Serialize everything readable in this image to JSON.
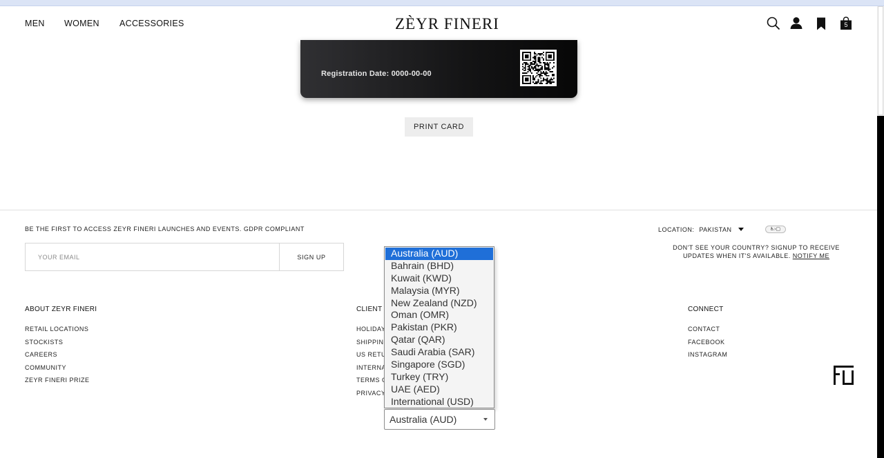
{
  "header": {
    "nav": [
      "MEN",
      "WOMEN",
      "ACCESSORIES"
    ],
    "logo": "ZÈYR FINERI",
    "cart_count": "5",
    "icons": [
      "search-icon",
      "user-icon",
      "bookmark-icon",
      "shopping-bag-icon"
    ]
  },
  "card": {
    "registration": "Registration Date: 0000-00-00"
  },
  "print_button": "PRINT CARD",
  "footer": {
    "newsletter_text": "BE THE FIRST TO ACCESS ZEYR FINERI LAUNCHES AND EVENTS. GDPR COMPLIANT",
    "email_placeholder": "YOUR EMAIL",
    "signup_label": "SIGN UP",
    "location_label": "LOCATION:",
    "location_value": "PAKISTAN",
    "notify_text": "DON'T SEE YOUR COUNTRY? SIGNUP TO RECEIVE UPDATES WHEN IT'S AVAILABLE.",
    "notify_link": "NOTIFY ME",
    "columns": {
      "about": {
        "heading": "ABOUT ZEYR FINERI",
        "items": [
          "RETAIL LOCATIONS",
          "STOCKISTS",
          "CAREERS",
          "COMMUNITY",
          "ZEYR FINERI PRIZE"
        ]
      },
      "client": {
        "heading": "CLIENT",
        "items": [
          "HOLIDAY",
          "SHIPPING",
          "US RETU",
          "INTERNA",
          "TERMS O",
          "PRIVACY"
        ]
      },
      "connect": {
        "heading": "CONNECT",
        "items": [
          "CONTACT",
          "FACEBOOK",
          "INSTAGRAM"
        ]
      }
    }
  },
  "currency_select": {
    "selected": "Australia (AUD)",
    "options": [
      "Australia (AUD)",
      "Bahrain (BHD)",
      "Kuwait (KWD)",
      "Malaysia (MYR)",
      "New Zealand (NZD)",
      "Oman (OMR)",
      "Pakistan (PKR)",
      "Qatar (QAR)",
      "Saudi Arabia (SAR)",
      "Singapore (SGD)",
      "Turkey (TRY)",
      "UAE (AED)",
      "International (USD)"
    ],
    "highlighted_index": 0
  },
  "colors": {
    "highlight": "#1f6fd8",
    "card_dark": "#141415"
  }
}
